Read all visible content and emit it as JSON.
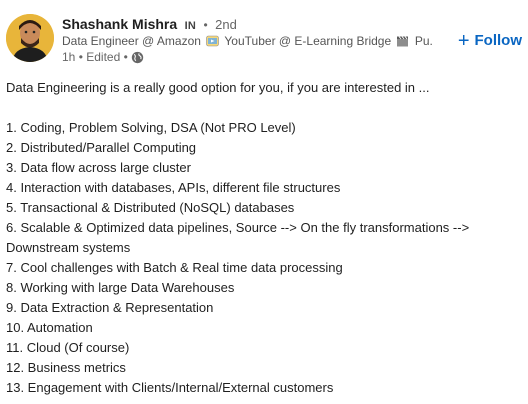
{
  "author": {
    "name": "Shashank Mishra",
    "badge": "IN",
    "degree": "2nd",
    "headline_part1": "Data Engineer @ Amazon",
    "headline_part2": "YouTuber @ E-Learning Bridge",
    "headline_part3": "Pu...",
    "time": "1h",
    "edited": "Edited"
  },
  "follow_label": "Follow",
  "post": {
    "intro": "Data Engineering is a really good option for you, if you are interested in ...",
    "items": [
      "1. Coding, Problem Solving, DSA (Not PRO Level)",
      "2. Distributed/Parallel Computing",
      "3. Data flow across large cluster",
      "4. Interaction with databases, APIs, different file structures",
      "5. Transactional & Distributed (NoSQL) databases",
      "6. Scalable & Optimized data pipelines, Source --> On the fly transformations --> Downstream systems",
      "7. Cool challenges with Batch & Real time data processing",
      "8. Working with large Data Warehouses",
      "9. Data Extraction & Representation",
      "10. Automation",
      "11. Cloud (Of course)",
      "12. Business metrics",
      "13. Engagement with Clients/Internal/External customers"
    ]
  },
  "icons": {
    "avatar": "avatar-photo",
    "emoji1": "youtube-emoji-icon",
    "emoji2": "clapper-board-emoji-icon",
    "visibility": "globe-icon"
  },
  "colors": {
    "accent": "#0a66c2",
    "text": "#1f1f1f",
    "muted": "#666666"
  }
}
